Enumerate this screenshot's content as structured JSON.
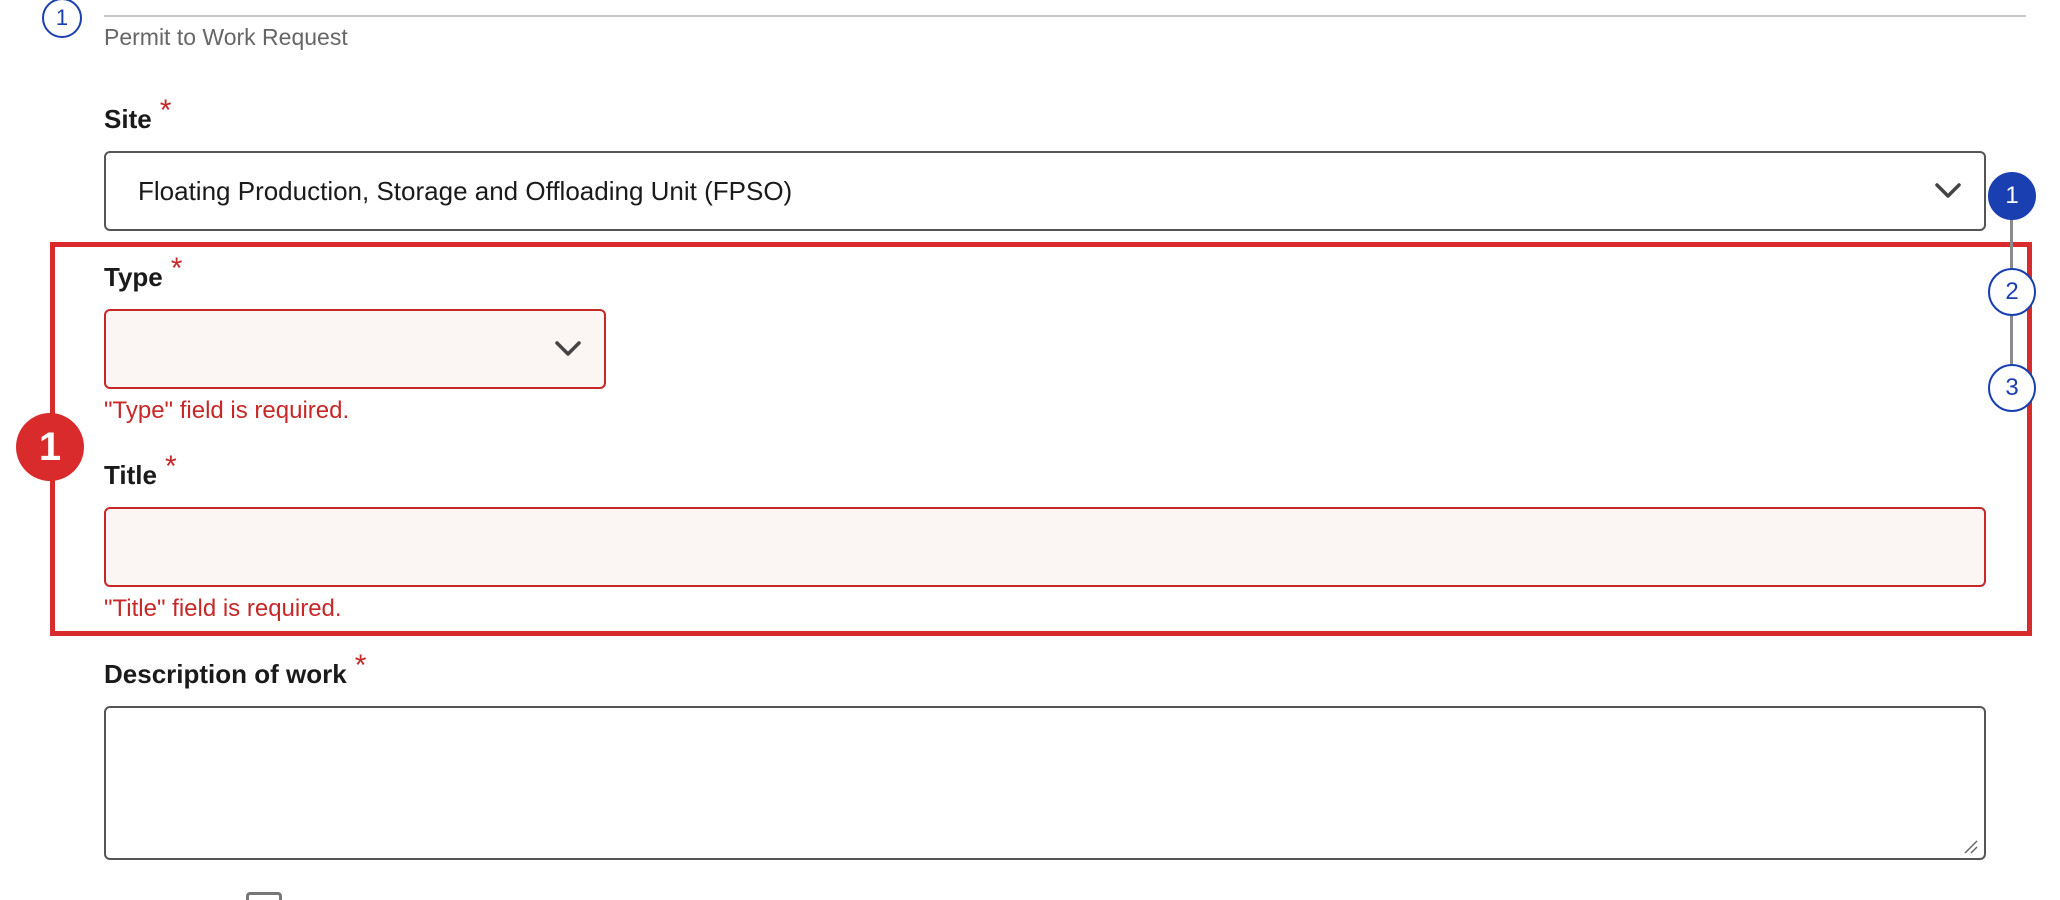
{
  "section": {
    "step_number": "1",
    "title": "Permit to Work Request"
  },
  "fields": {
    "site": {
      "label": "Site",
      "required_mark": "*",
      "value": "Floating Production, Storage and Offloading Unit (FPSO)"
    },
    "type": {
      "label": "Type",
      "required_mark": "*",
      "value": "",
      "error": "\"Type\" field is required."
    },
    "title": {
      "label": "Title",
      "required_mark": "*",
      "value": "",
      "error": "\"Title\" field is required."
    },
    "description": {
      "label": "Description of work",
      "required_mark": "*",
      "value": ""
    }
  },
  "annotation": {
    "badge": "1",
    "color": "#d92b2b"
  },
  "stepper": {
    "steps": [
      {
        "label": "1",
        "state": "active"
      },
      {
        "label": "2",
        "state": "inactive"
      },
      {
        "label": "3",
        "state": "inactive"
      }
    ]
  },
  "colors": {
    "accent": "#1a3fb0",
    "error": "#c62828",
    "invalid_field_bg": "#fbf5f4"
  },
  "icons": {
    "select_chevron": "chevron-down-icon",
    "resize_grip": "resize-grip-icon"
  }
}
